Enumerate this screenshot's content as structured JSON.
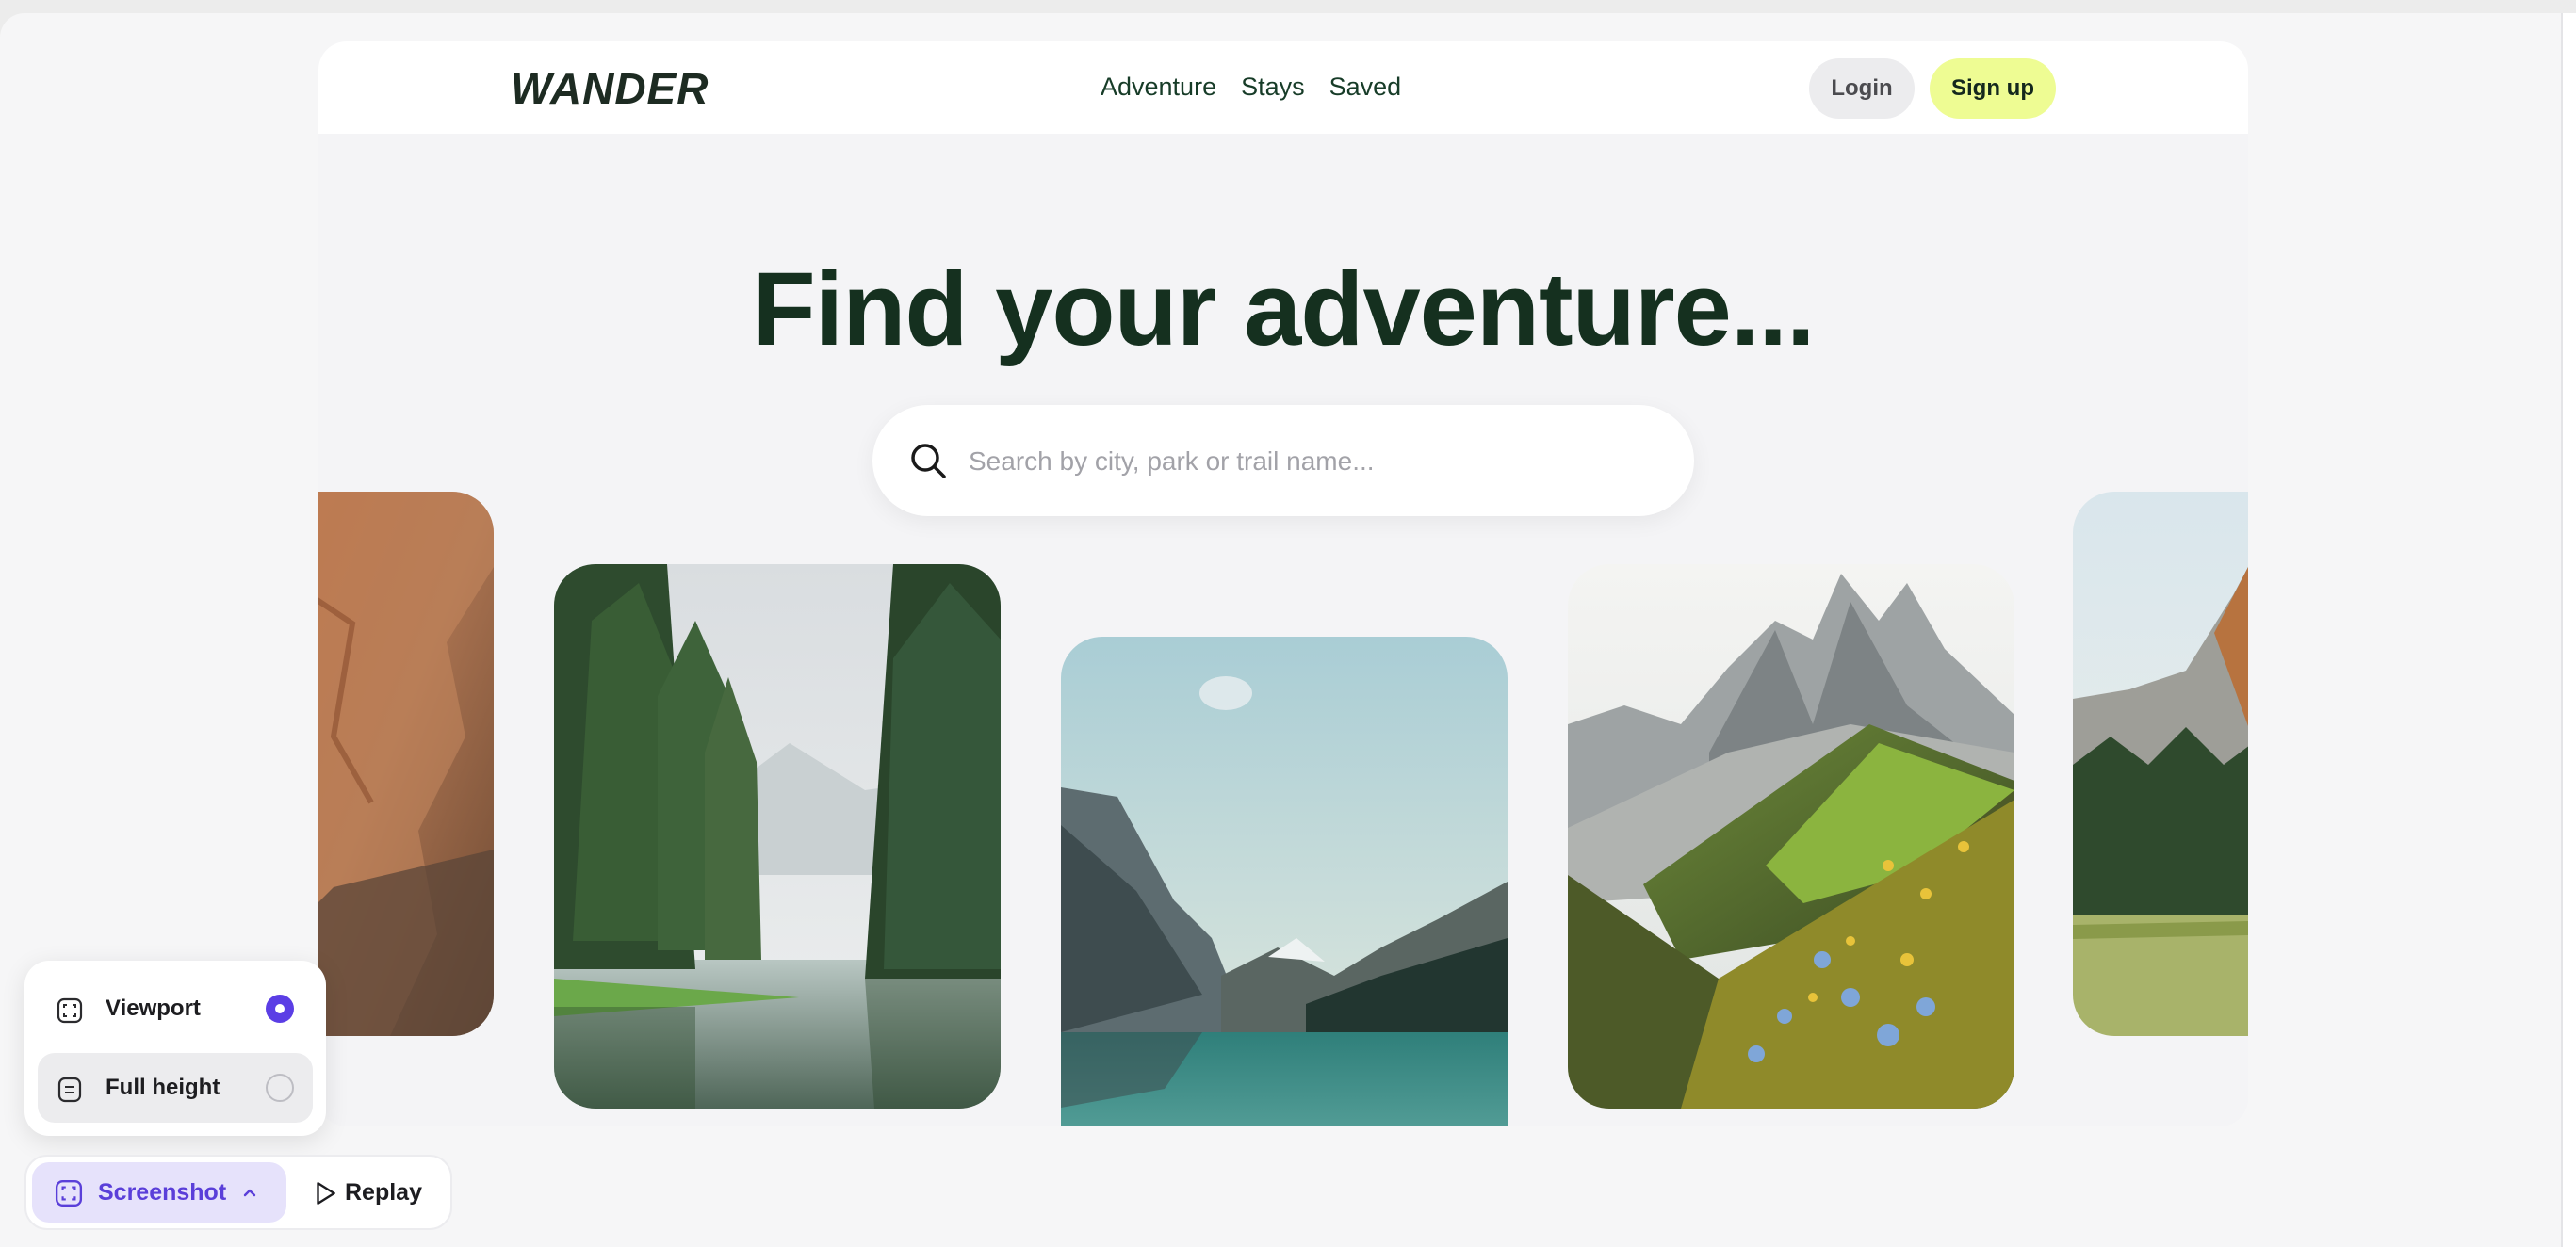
{
  "nav": {
    "logo": "WANDER",
    "links": [
      "Adventure",
      "Stays",
      "Saved"
    ],
    "login": "Login",
    "signup": "Sign up"
  },
  "hero": {
    "title": "Find your adventure...",
    "search_placeholder": "Search by city, park or trail name..."
  },
  "capture_menu": {
    "options": [
      {
        "label": "Viewport",
        "selected": true
      },
      {
        "label": "Full height",
        "selected": false
      }
    ]
  },
  "toolbar": {
    "screenshot": "Screenshot",
    "replay": "Replay"
  },
  "colors": {
    "accent": "#5b3ee5",
    "signup_bg": "#eefc93",
    "title": "#15301f"
  }
}
